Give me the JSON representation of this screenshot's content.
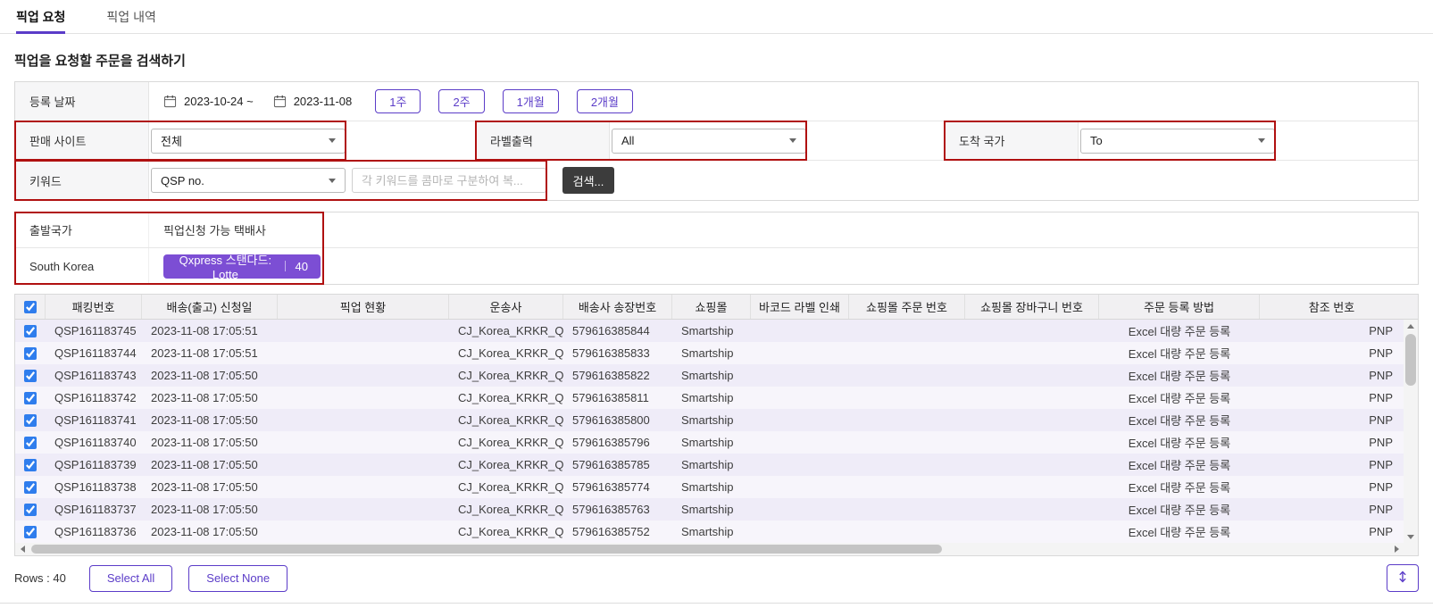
{
  "tabs": [
    {
      "label": "픽업 요청",
      "active": true
    },
    {
      "label": "픽업 내역",
      "active": false
    }
  ],
  "page_title": "픽업을 요청할 주문을 검색하기",
  "filters": {
    "date_label": "등록 날짜",
    "date_from": "2023-10-24 ~",
    "date_to": "2023-11-08",
    "period_buttons": [
      "1주",
      "2주",
      "1개월",
      "2개월"
    ],
    "sale_site": {
      "label": "판매 사이트",
      "value": "전체"
    },
    "label_print": {
      "label": "라벨출력",
      "value": "All"
    },
    "arrival_country": {
      "label": "도착 국가",
      "value": "To"
    },
    "keyword": {
      "label": "키워드",
      "type_value": "QSP no.",
      "placeholder": "각 키워드를 콤마로 구분하여 복...",
      "search_label": "검색..."
    }
  },
  "pickup_panel": {
    "origin_header": "출발국가",
    "courier_header": "픽업신청 가능 택배사",
    "origin_value": "South Korea",
    "courier_name": "Qxpress 스탠다드: Lotte",
    "courier_count": "40"
  },
  "table": {
    "columns": [
      "패킹번호",
      "배송(출고) 신청일",
      "픽업 현황",
      "운송사",
      "배송사 송장번호",
      "쇼핑몰",
      "바코드 라벨 인쇄",
      "쇼핑몰 주문 번호",
      "쇼핑몰 장바구니 번호",
      "주문 등록 방법",
      "참조 번호"
    ],
    "rows": [
      {
        "packing": "QSP161183745",
        "date": "2023-11-08 17:05:51",
        "pickup_status": "",
        "carrier": "CJ_Korea_KRKR_Q...",
        "tracking": "579616385844",
        "mall": "Smartship",
        "barcode_print": "",
        "order_no": "",
        "cart_no": "",
        "reg_method": "Excel 대량 주문 등록",
        "ref": "PNP"
      },
      {
        "packing": "QSP161183744",
        "date": "2023-11-08 17:05:51",
        "pickup_status": "",
        "carrier": "CJ_Korea_KRKR_Q...",
        "tracking": "579616385833",
        "mall": "Smartship",
        "barcode_print": "",
        "order_no": "",
        "cart_no": "",
        "reg_method": "Excel 대량 주문 등록",
        "ref": "PNP"
      },
      {
        "packing": "QSP161183743",
        "date": "2023-11-08 17:05:50",
        "pickup_status": "",
        "carrier": "CJ_Korea_KRKR_Q...",
        "tracking": "579616385822",
        "mall": "Smartship",
        "barcode_print": "",
        "order_no": "",
        "cart_no": "",
        "reg_method": "Excel 대량 주문 등록",
        "ref": "PNP"
      },
      {
        "packing": "QSP161183742",
        "date": "2023-11-08 17:05:50",
        "pickup_status": "",
        "carrier": "CJ_Korea_KRKR_Q...",
        "tracking": "579616385811",
        "mall": "Smartship",
        "barcode_print": "",
        "order_no": "",
        "cart_no": "",
        "reg_method": "Excel 대량 주문 등록",
        "ref": "PNP"
      },
      {
        "packing": "QSP161183741",
        "date": "2023-11-08 17:05:50",
        "pickup_status": "",
        "carrier": "CJ_Korea_KRKR_Q...",
        "tracking": "579616385800",
        "mall": "Smartship",
        "barcode_print": "",
        "order_no": "",
        "cart_no": "",
        "reg_method": "Excel 대량 주문 등록",
        "ref": "PNP"
      },
      {
        "packing": "QSP161183740",
        "date": "2023-11-08 17:05:50",
        "pickup_status": "",
        "carrier": "CJ_Korea_KRKR_Q...",
        "tracking": "579616385796",
        "mall": "Smartship",
        "barcode_print": "",
        "order_no": "",
        "cart_no": "",
        "reg_method": "Excel 대량 주문 등록",
        "ref": "PNP"
      },
      {
        "packing": "QSP161183739",
        "date": "2023-11-08 17:05:50",
        "pickup_status": "",
        "carrier": "CJ_Korea_KRKR_Q...",
        "tracking": "579616385785",
        "mall": "Smartship",
        "barcode_print": "",
        "order_no": "",
        "cart_no": "",
        "reg_method": "Excel 대량 주문 등록",
        "ref": "PNP"
      },
      {
        "packing": "QSP161183738",
        "date": "2023-11-08 17:05:50",
        "pickup_status": "",
        "carrier": "CJ_Korea_KRKR_Q...",
        "tracking": "579616385774",
        "mall": "Smartship",
        "barcode_print": "",
        "order_no": "",
        "cart_no": "",
        "reg_method": "Excel 대량 주문 등록",
        "ref": "PNP"
      },
      {
        "packing": "QSP161183737",
        "date": "2023-11-08 17:05:50",
        "pickup_status": "",
        "carrier": "CJ_Korea_KRKR_Q...",
        "tracking": "579616385763",
        "mall": "Smartship",
        "barcode_print": "",
        "order_no": "",
        "cart_no": "",
        "reg_method": "Excel 대량 주문 등록",
        "ref": "PNP"
      },
      {
        "packing": "QSP161183736",
        "date": "2023-11-08 17:05:50",
        "pickup_status": "",
        "carrier": "CJ_Korea_KRKR_Q...",
        "tracking": "579616385752",
        "mall": "Smartship",
        "barcode_print": "",
        "order_no": "",
        "cart_no": "",
        "reg_method": "Excel 대량 주문 등록",
        "ref": "PNP"
      }
    ]
  },
  "footer": {
    "rows_label": "Rows : 40",
    "select_all": "Select All",
    "select_none": "Select None"
  },
  "colors": {
    "accent": "#5b3cc8",
    "badge": "#7c4ed4",
    "annotation": "#b01010",
    "checkbox": "#2f7ded"
  }
}
